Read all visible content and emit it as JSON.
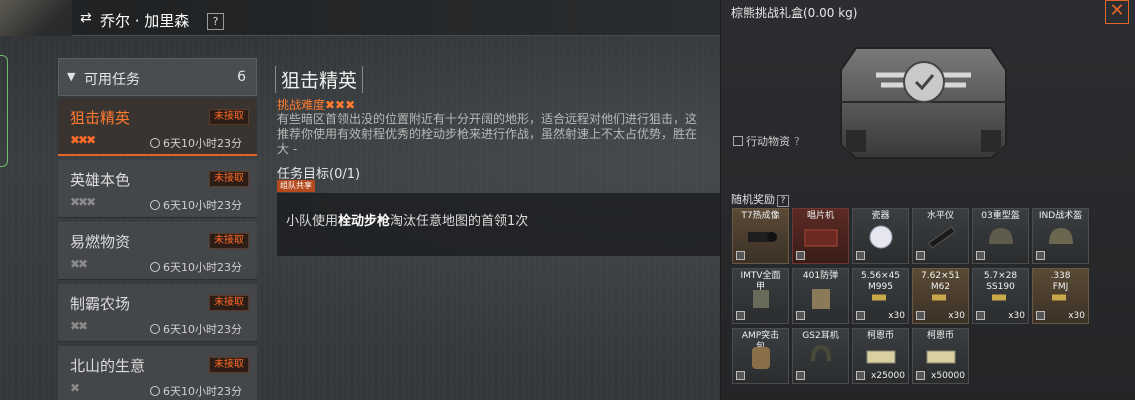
{
  "header": {
    "swap_icon": "swap-arrows",
    "character_name": "乔尔 · 加里森",
    "help": "?"
  },
  "task_list": {
    "header_label": "可用任务",
    "count": "6",
    "items": [
      {
        "name": "狙击精英",
        "badge": "未接取",
        "stars": "✖✖✖",
        "time": "6天10小时23分",
        "active": true
      },
      {
        "name": "英雄本色",
        "badge": "未接取",
        "stars": "✖✖✖",
        "time": "6天10小时23分",
        "active": false
      },
      {
        "name": "易燃物资",
        "badge": "未接取",
        "stars": "✖✖",
        "time": "6天10小时23分",
        "active": false
      },
      {
        "name": "制霸农场",
        "badge": "未接取",
        "stars": "✖✖",
        "time": "6天10小时23分",
        "active": false
      },
      {
        "name": "北山的生意",
        "badge": "未接取",
        "stars": "✖",
        "time": "6天10小时23分",
        "active": false
      }
    ]
  },
  "detail": {
    "title": "狙击精英",
    "difficulty": "挑战难度✖✖✖",
    "desc_line1": "有些暗区首领出没的位置附近有十分开阔的地形，适合远程对他们进行狙击，这",
    "desc_line2": "推荐你使用有效射程优秀的栓动步枪来进行作战，虽然射速上不太占优势，胜在",
    "desc_line3": "大 -",
    "goal_label": "任务目标(0/1)",
    "share_tag": "组队共享",
    "goal_pre": "小队使用",
    "goal_bold": "栓动步枪",
    "goal_post": "淘汰任意地图的首领1次"
  },
  "reward_panel": {
    "box_title": "棕熊挑战礼盒(0.00 kg)",
    "close": "✕",
    "supply_label": "行动物资",
    "supply_help": "?",
    "random_label": "随机奖励",
    "random_help": "?",
    "items": [
      {
        "name": "T7热成像",
        "qty": "",
        "style": "brown"
      },
      {
        "name": "唱片机",
        "qty": "",
        "style": "red"
      },
      {
        "name": "瓷器",
        "qty": "",
        "style": ""
      },
      {
        "name": "水平仪",
        "qty": "",
        "style": ""
      },
      {
        "name": "03重型盔",
        "qty": "",
        "style": ""
      },
      {
        "name": "IND战术盔",
        "qty": "",
        "style": ""
      },
      {
        "name": "IMTV全面甲",
        "qty": "",
        "style": ""
      },
      {
        "name": "401防弹",
        "qty": "",
        "style": ""
      },
      {
        "name": "5.56×45 M995",
        "qty": "x30",
        "style": ""
      },
      {
        "name": "7.62×51 M62",
        "qty": "x30",
        "style": "brown"
      },
      {
        "name": "5.7×28 SS190",
        "qty": "x30",
        "style": ""
      },
      {
        "name": ".338 FMJ",
        "qty": "x30",
        "style": "brown"
      },
      {
        "name": "AMP突击包",
        "qty": "",
        "style": ""
      },
      {
        "name": "GS2耳机",
        "qty": "",
        "style": ""
      },
      {
        "name": "柯恩币",
        "qty": "x25000",
        "style": ""
      },
      {
        "name": "柯恩币",
        "qty": "x50000",
        "style": ""
      }
    ]
  },
  "colors": {
    "accent_orange": "#ff7a2e",
    "badge_red": "#ff6a2a",
    "panel_dark": "#232527"
  }
}
